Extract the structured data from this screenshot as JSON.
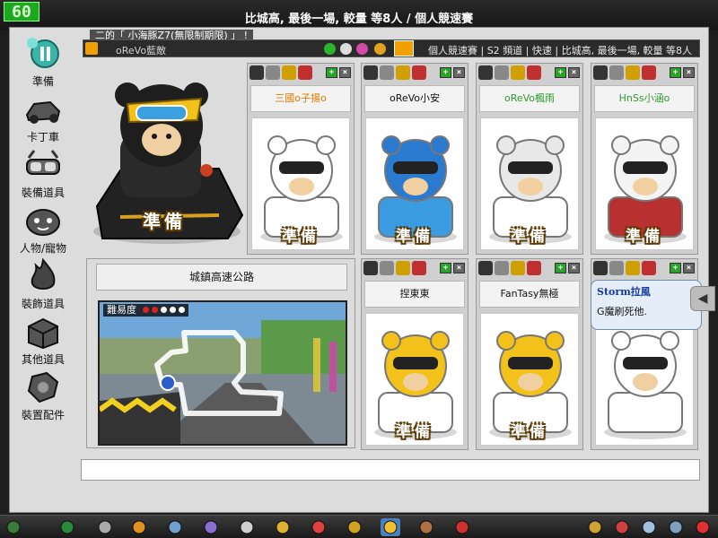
{
  "fps": "60",
  "room_title": "比城高, 最後一場, 較量  等8人  /  個人競速賽",
  "broadcast": "二的「  小海豚Z7(無限制期限)  」 !",
  "info_bar": {
    "host": "oReVo藍敵",
    "detail": "個人競速賽  |  S2 頻道  |  快速  |  比城高, 最後一場, 較量  等8人"
  },
  "left_menu": [
    {
      "label": "準備",
      "icon": "pause-icon"
    },
    {
      "label": "卡丁車",
      "icon": "kart-icon"
    },
    {
      "label": "裝備道具",
      "icon": "goggles-icon"
    },
    {
      "label": "人物/寵物",
      "icon": "character-icon"
    },
    {
      "label": "裝飾道具",
      "icon": "flame-icon"
    },
    {
      "label": "其他道具",
      "icon": "box-icon"
    },
    {
      "label": "裝置配件",
      "icon": "gear-icon"
    }
  ],
  "my_kart": {
    "ready_label": "準備"
  },
  "players": [
    {
      "name": "三國o子揚o",
      "name_color": "#e07b00",
      "ready": "準備",
      "body": "#ffffff",
      "helmet": "#ffffff"
    },
    {
      "name": "oReVo小安",
      "name_color": "#111111",
      "ready": "準備",
      "body": "#3b9be0",
      "helmet": "#2a7bd0"
    },
    {
      "name": "oReVo楓雨",
      "name_color": "#2e9a2e",
      "ready": "準備",
      "body": "#ffffff",
      "helmet": "#e8e8e8"
    },
    {
      "name": "HnSs小涵o",
      "name_color": "#2e9a2e",
      "ready": "準備",
      "body": "#b83030",
      "helmet": "#f4f4f4"
    },
    {
      "name": "捏東東",
      "name_color": "#111111",
      "ready": "準備",
      "body": "#ffffff",
      "helmet": "#f2c21a"
    },
    {
      "name": "FanTasy無極",
      "name_color": "#111111",
      "ready": "準備",
      "body": "#ffffff",
      "helmet": "#f2c21a"
    },
    {
      "name": "",
      "name_color": "#111111",
      "ready": "",
      "body": "#ffffff",
      "helmet": "#ffffff"
    }
  ],
  "track": {
    "name": "城鎮高速公路",
    "difficulty_label": "難易度",
    "difficulty_level": 2,
    "difficulty_max": 5
  },
  "tooltip": {
    "name": "Storm拉風",
    "message": "G魔刷死他."
  },
  "taskbar": [
    "trophy-icon",
    "back-icon",
    "cart-icon",
    "star-icon",
    "gear-icon",
    "box-icon",
    "shield-icon",
    "rocket-icon",
    "heart-icon",
    "tool-icon",
    "glove-icon",
    "book-icon",
    "circle-icon",
    "note-icon",
    "mail-icon",
    "settings-icon",
    "search-icon",
    "power-icon"
  ]
}
